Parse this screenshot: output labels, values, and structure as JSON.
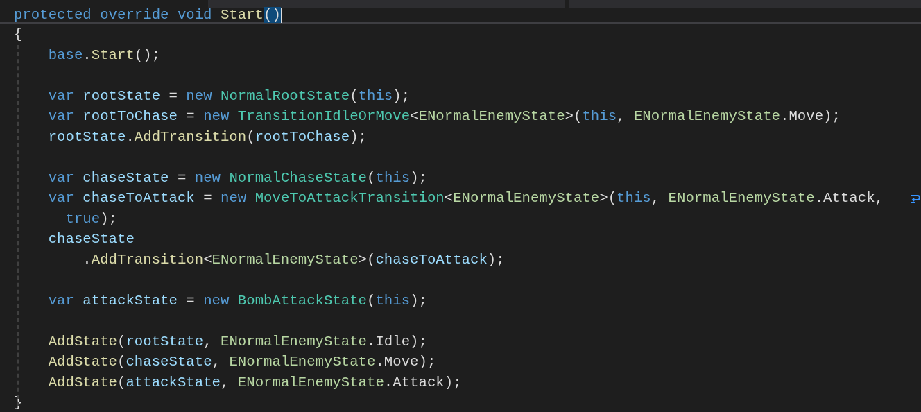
{
  "sticky_header": {
    "tokens": [
      {
        "kind": "keyword",
        "t": "protected override void "
      },
      {
        "kind": "method",
        "t": "Start"
      },
      {
        "kind": "match",
        "t": "()"
      }
    ]
  },
  "lines": [
    {
      "wrapped": false,
      "tokens": [
        {
          "kind": "plain",
          "t": "{"
        }
      ]
    },
    {
      "wrapped": false,
      "tokens": [
        {
          "kind": "keyword",
          "t": "    base"
        },
        {
          "kind": "plain",
          "t": "."
        },
        {
          "kind": "method",
          "t": "Start"
        },
        {
          "kind": "plain",
          "t": "();"
        }
      ]
    },
    {
      "wrapped": false
    },
    {
      "wrapped": false,
      "tokens": [
        {
          "kind": "keyword",
          "t": "    var "
        },
        {
          "kind": "variable",
          "t": "rootState"
        },
        {
          "kind": "plain",
          "t": " = "
        },
        {
          "kind": "keyword",
          "t": "new "
        },
        {
          "kind": "type",
          "t": "NormalRootState"
        },
        {
          "kind": "plain",
          "t": "("
        },
        {
          "kind": "keyword",
          "t": "this"
        },
        {
          "kind": "plain",
          "t": ");"
        }
      ]
    },
    {
      "wrapped": false,
      "tokens": [
        {
          "kind": "keyword",
          "t": "    var "
        },
        {
          "kind": "variable",
          "t": "rootToChase"
        },
        {
          "kind": "plain",
          "t": " = "
        },
        {
          "kind": "keyword",
          "t": "new "
        },
        {
          "kind": "type",
          "t": "TransitionIdleOrMove"
        },
        {
          "kind": "plain",
          "t": "<"
        },
        {
          "kind": "enum",
          "t": "ENormalEnemyState"
        },
        {
          "kind": "plain",
          "t": ">("
        },
        {
          "kind": "keyword",
          "t": "this"
        },
        {
          "kind": "plain",
          "t": ", "
        },
        {
          "kind": "enum",
          "t": "ENormalEnemyState"
        },
        {
          "kind": "plain",
          "t": ".Move);"
        }
      ]
    },
    {
      "wrapped": false,
      "tokens": [
        {
          "kind": "variable",
          "t": "    rootState"
        },
        {
          "kind": "plain",
          "t": "."
        },
        {
          "kind": "method",
          "t": "AddTransition"
        },
        {
          "kind": "plain",
          "t": "("
        },
        {
          "kind": "variable",
          "t": "rootToChase"
        },
        {
          "kind": "plain",
          "t": ");"
        }
      ]
    },
    {
      "wrapped": false
    },
    {
      "wrapped": false,
      "tokens": [
        {
          "kind": "keyword",
          "t": "    var "
        },
        {
          "kind": "variable",
          "t": "chaseState"
        },
        {
          "kind": "plain",
          "t": " = "
        },
        {
          "kind": "keyword",
          "t": "new "
        },
        {
          "kind": "type",
          "t": "NormalChaseState"
        },
        {
          "kind": "plain",
          "t": "("
        },
        {
          "kind": "keyword",
          "t": "this"
        },
        {
          "kind": "plain",
          "t": ");"
        }
      ]
    },
    {
      "wrapped": true,
      "tokens": [
        {
          "kind": "keyword",
          "t": "    var "
        },
        {
          "kind": "variable",
          "t": "chaseToAttack"
        },
        {
          "kind": "plain",
          "t": " = "
        },
        {
          "kind": "keyword",
          "t": "new "
        },
        {
          "kind": "type",
          "t": "MoveToAttackTransition"
        },
        {
          "kind": "plain",
          "t": "<"
        },
        {
          "kind": "enum",
          "t": "ENormalEnemyState"
        },
        {
          "kind": "plain",
          "t": ">("
        },
        {
          "kind": "keyword",
          "t": "this"
        },
        {
          "kind": "plain",
          "t": ", "
        },
        {
          "kind": "enum",
          "t": "ENormalEnemyState"
        },
        {
          "kind": "plain",
          "t": ".Attack,"
        }
      ]
    },
    {
      "wrapped": false,
      "tokens": [
        {
          "kind": "keyword",
          "t": "      true"
        },
        {
          "kind": "plain",
          "t": ");"
        }
      ]
    },
    {
      "wrapped": false,
      "tokens": [
        {
          "kind": "variable",
          "t": "    chaseState"
        }
      ]
    },
    {
      "wrapped": false,
      "tokens": [
        {
          "kind": "plain",
          "t": "        ."
        },
        {
          "kind": "method",
          "t": "AddTransition"
        },
        {
          "kind": "plain",
          "t": "<"
        },
        {
          "kind": "enum",
          "t": "ENormalEnemyState"
        },
        {
          "kind": "plain",
          "t": ">("
        },
        {
          "kind": "variable",
          "t": "chaseToAttack"
        },
        {
          "kind": "plain",
          "t": ");"
        }
      ]
    },
    {
      "wrapped": false
    },
    {
      "wrapped": false,
      "tokens": [
        {
          "kind": "keyword",
          "t": "    var "
        },
        {
          "kind": "variable",
          "t": "attackState"
        },
        {
          "kind": "plain",
          "t": " = "
        },
        {
          "kind": "keyword",
          "t": "new "
        },
        {
          "kind": "type",
          "t": "BombAttackState"
        },
        {
          "kind": "plain",
          "t": "("
        },
        {
          "kind": "keyword",
          "t": "this"
        },
        {
          "kind": "plain",
          "t": ");"
        }
      ]
    },
    {
      "wrapped": false
    },
    {
      "wrapped": false,
      "tokens": [
        {
          "kind": "method",
          "t": "    AddState"
        },
        {
          "kind": "plain",
          "t": "("
        },
        {
          "kind": "variable",
          "t": "rootState"
        },
        {
          "kind": "plain",
          "t": ", "
        },
        {
          "kind": "enum",
          "t": "ENormalEnemyState"
        },
        {
          "kind": "plain",
          "t": ".Idle);"
        }
      ]
    },
    {
      "wrapped": false,
      "tokens": [
        {
          "kind": "method",
          "t": "    AddState"
        },
        {
          "kind": "plain",
          "t": "("
        },
        {
          "kind": "variable",
          "t": "chaseState"
        },
        {
          "kind": "plain",
          "t": ", "
        },
        {
          "kind": "enum",
          "t": "ENormalEnemyState"
        },
        {
          "kind": "plain",
          "t": ".Move);"
        }
      ]
    },
    {
      "wrapped": false,
      "tokens": [
        {
          "kind": "method",
          "t": "    AddState"
        },
        {
          "kind": "plain",
          "t": "("
        },
        {
          "kind": "variable",
          "t": "attackState"
        },
        {
          "kind": "plain",
          "t": ", "
        },
        {
          "kind": "enum",
          "t": "ENormalEnemyState"
        },
        {
          "kind": "plain",
          "t": ".Attack);"
        }
      ]
    },
    {
      "wrapped": false,
      "tokens": [
        {
          "kind": "plain",
          "t": "}"
        }
      ]
    }
  ]
}
